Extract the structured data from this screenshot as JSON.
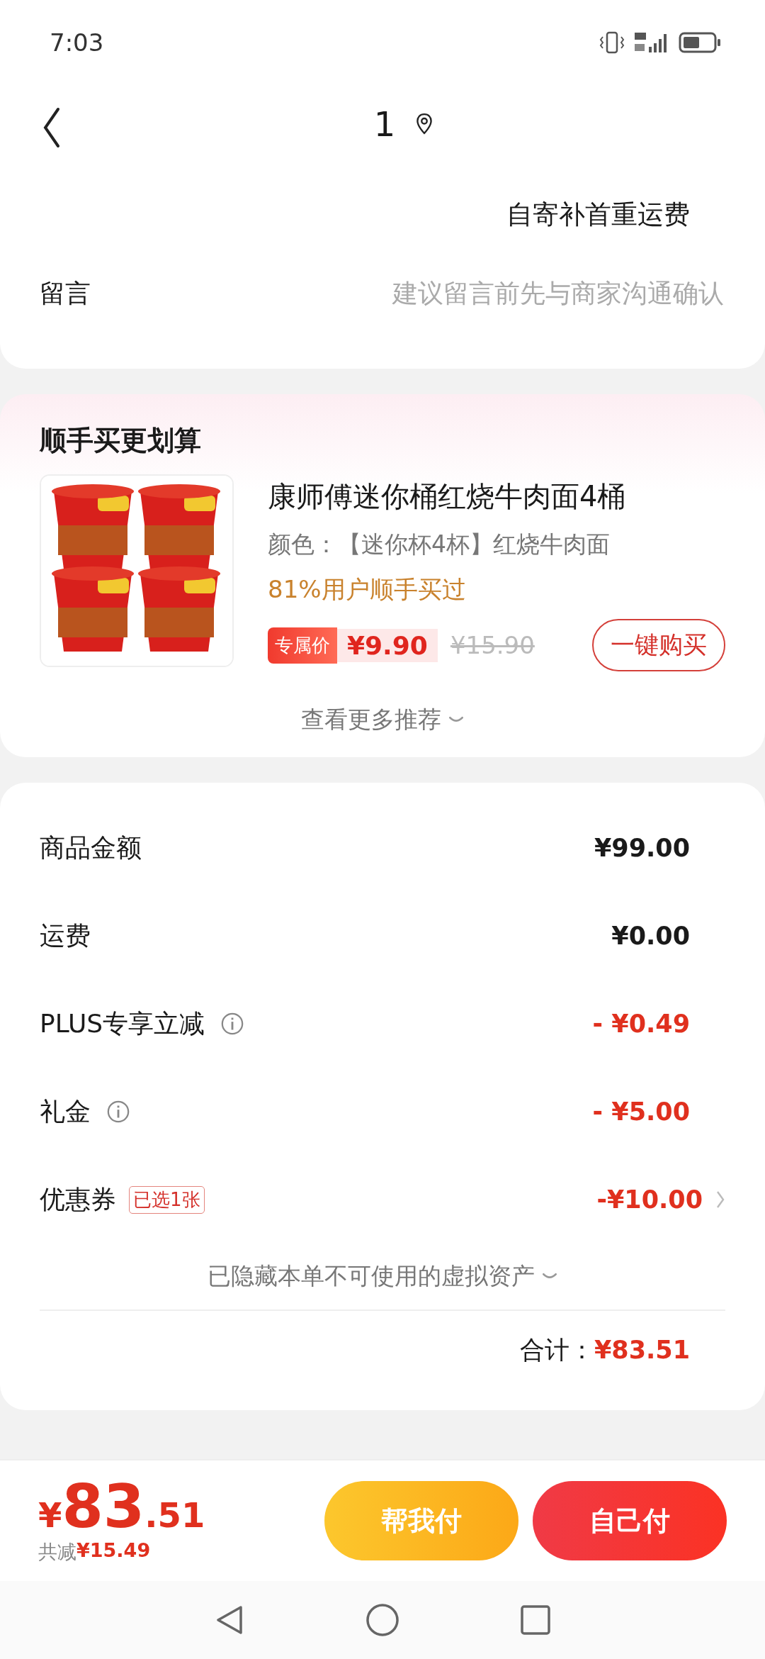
{
  "status_bar": {
    "time": "7:03"
  },
  "header": {
    "title": "1"
  },
  "shipping": {
    "note": "自寄补首重运费"
  },
  "message": {
    "label": "留言",
    "placeholder": "建议留言前先与商家沟通确认"
  },
  "recommend": {
    "title": "顺手买更划算",
    "product": {
      "name": "康师傅迷你桶红烧牛肉面4桶",
      "spec": "颜色：【迷你杯4杯】红烧牛肉面",
      "social": "81%用户顺手买过",
      "price_tag": "专属价",
      "price": "¥9.90",
      "original_price": "¥15.90",
      "buy_button": "一键购买"
    },
    "more": "查看更多推荐"
  },
  "summary": {
    "rows": [
      {
        "label": "商品金额",
        "value": "¥99.00",
        "kind": "plain",
        "info": false,
        "chevron": false
      },
      {
        "label": "运费",
        "value": "¥0.00",
        "kind": "plain",
        "info": false,
        "chevron": false
      },
      {
        "label": "PLUS专享立减",
        "value": "- ¥0.49",
        "kind": "discount",
        "info": true,
        "chevron": false
      },
      {
        "label": "礼金",
        "value": "- ¥5.00",
        "kind": "discount",
        "info": true,
        "chevron": false
      },
      {
        "label": "优惠券",
        "badge": "已选1张",
        "value": "-¥10.00",
        "kind": "discount",
        "info": false,
        "chevron": true
      }
    ],
    "hidden_note": "已隐藏本单不可使用的虚拟资产",
    "total_label": "合计：",
    "total": "¥83.51"
  },
  "footer": {
    "currency": "¥",
    "price_int": "83",
    "price_dec": ".51",
    "saved_label": "共减",
    "saved": "¥15.49",
    "buttons": [
      {
        "label": "帮我付",
        "kind": "secondary"
      },
      {
        "label": "自己付",
        "kind": "primary"
      }
    ]
  }
}
